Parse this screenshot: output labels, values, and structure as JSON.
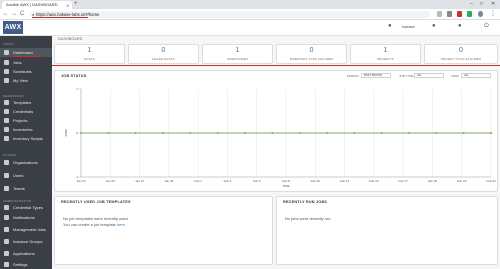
{
  "browser": {
    "tab_title": "Ansible AWX | DASHBOARD",
    "url": "https://awx.hakase-labs.io/#/home",
    "new_tab": "+",
    "back": "←",
    "forward": "→",
    "reload": "C"
  },
  "header": {
    "logo": "AWX",
    "user": "hakase"
  },
  "sidebar": {
    "sections": [
      {
        "label": "VIEWS"
      },
      {
        "label": "RESOURCES"
      },
      {
        "label": "ACCESS"
      },
      {
        "label": "ADMINISTRATION"
      }
    ],
    "items": [
      {
        "label": "Dashboard",
        "icon": "dashboard-icon"
      },
      {
        "label": "Jobs",
        "icon": "rocket-icon"
      },
      {
        "label": "Schedules",
        "icon": "calendar-icon"
      },
      {
        "label": "My View",
        "icon": "eye-icon"
      },
      {
        "label": "Templates",
        "icon": "pencil-icon"
      },
      {
        "label": "Credentials",
        "icon": "key-icon"
      },
      {
        "label": "Projects",
        "icon": "folder-icon"
      },
      {
        "label": "Inventories",
        "icon": "sitemap-icon"
      },
      {
        "label": "Inventory Scripts",
        "icon": "code-icon"
      },
      {
        "label": "Organizations",
        "icon": "building-icon"
      },
      {
        "label": "Users",
        "icon": "user-icon"
      },
      {
        "label": "Teams",
        "icon": "users-icon"
      },
      {
        "label": "Credential Types",
        "icon": "key-type-icon"
      },
      {
        "label": "Notifications",
        "icon": "bell-icon"
      },
      {
        "label": "Management Jobs",
        "icon": "briefcase-icon"
      },
      {
        "label": "Instance Groups",
        "icon": "server-icon"
      },
      {
        "label": "Applications",
        "icon": "cube-icon"
      },
      {
        "label": "Settings",
        "icon": "gear-icon"
      }
    ]
  },
  "breadcrumb": "DASHBOARD",
  "counts": [
    {
      "value": "1",
      "label": "HOSTS"
    },
    {
      "value": "0",
      "label": "FAILED HOSTS"
    },
    {
      "value": "1",
      "label": "INVENTORIES"
    },
    {
      "value": "0",
      "label": "INVENTORY SYNC FAILURES"
    },
    {
      "value": "1",
      "label": "PROJECTS"
    },
    {
      "value": "0",
      "label": "PROJECT SYNC FAILURES"
    }
  ],
  "job_status": {
    "title": "JOB STATUS",
    "filters": [
      {
        "label": "PERIOD",
        "value": "PAST MONTH"
      },
      {
        "label": "JOB TYPE",
        "value": "ALL"
      },
      {
        "label": "VIEW",
        "value": "ALL"
      }
    ]
  },
  "chart_data": {
    "type": "line",
    "x": [
      "Jan 24",
      "Jan 26",
      "Jan 28",
      "Jan 30",
      "Feb 1",
      "Feb 3",
      "Feb 5",
      "Feb 7",
      "Feb 9",
      "Feb 11",
      "Feb 13",
      "Feb 15",
      "Feb 17",
      "Feb 19",
      "Feb 21",
      "Feb 23"
    ],
    "x_ticks": [
      "Jan 24",
      "Jan 25",
      "Jan 27",
      "Jan 30",
      "Feb 1",
      "Feb 4",
      "Feb 6",
      "Feb 8",
      "Feb 10",
      "Feb 13",
      "Feb 15",
      "Feb 17",
      "Feb 20",
      "Feb 22",
      "Feb 24"
    ],
    "series": [
      {
        "values": [
          0,
          0,
          0,
          0,
          0,
          0,
          0,
          0,
          0,
          0,
          0,
          0,
          0,
          0,
          0,
          0
        ],
        "color": "#d9534f"
      },
      {
        "values": [
          0,
          0,
          0,
          0,
          0,
          0,
          0,
          0,
          0,
          0,
          0,
          0,
          0,
          0,
          0,
          0
        ],
        "color": "#5cb85c"
      }
    ],
    "xlabel": "TIME",
    "ylabel": "JOBS",
    "y_ticks": [
      "1",
      "0",
      "-1"
    ],
    "ylim": [
      -1,
      1
    ]
  },
  "recent_templates": {
    "title": "RECENTLY USED JOB TEMPLATES",
    "line1": "No job templates were recently used.",
    "line2_prefix": "You can create a job template ",
    "line2_link": "here",
    "line2_suffix": "."
  },
  "recent_jobs": {
    "title": "RECENTLY RUN JOBS",
    "message": "No jobs were recently run."
  },
  "colors": {
    "sidebar": "#393f44",
    "accent": "#337ab7",
    "annotation": "#c9302c"
  }
}
